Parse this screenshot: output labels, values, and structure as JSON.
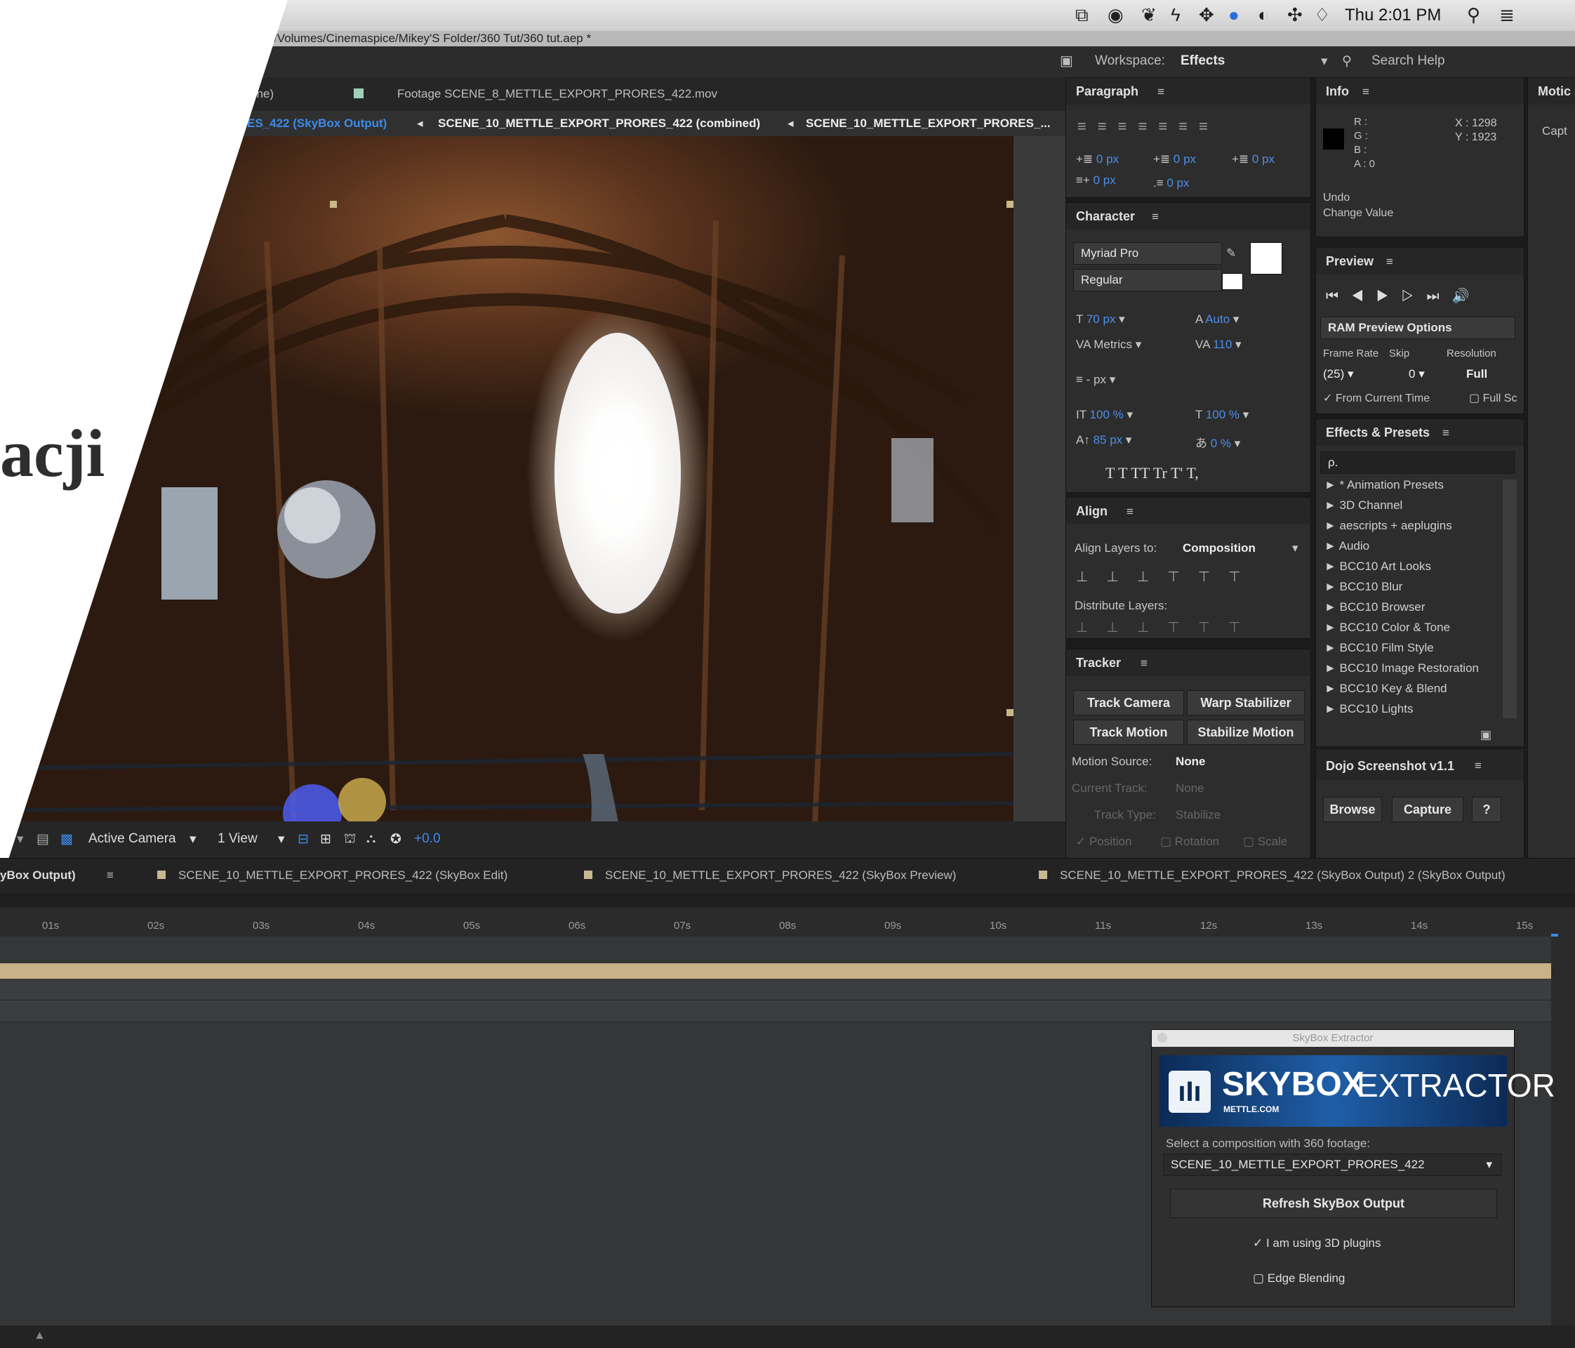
{
  "menubar": {
    "clock": "Thu 2:01 PM"
  },
  "path": "/Volumes/Cinemaspice/Mikey'S Folder/360 Tut/360 tut.aep *",
  "overlay_text": "acji",
  "workspace": {
    "label": "Workspace:",
    "value": "Effects",
    "search": "Search Help"
  },
  "viewer": {
    "top_tabs": [
      "one)",
      "Footage SCENE_8_METTLE_EXPORT_PRORES_422.mov"
    ],
    "comp_tabs": [
      "ES_422 (SkyBox Output)",
      "SCENE_10_METTLE_EXPORT_PRORES_422 (combined)",
      "SCENE_10_METTLE_EXPORT_PRORES_..."
    ],
    "toolbar": {
      "camera": "Active Camera",
      "view": "1 View",
      "exposure": "+0.0"
    }
  },
  "paragraph": {
    "title": "Paragraph",
    "indents": [
      "0 px",
      "0 px",
      "0 px",
      "0 px",
      "0 px"
    ]
  },
  "character": {
    "title": "Character",
    "font": "Myriad Pro",
    "style": "Regular",
    "size": "70 px",
    "leading": "Auto",
    "kerning": "Metrics",
    "tracking": "110",
    "stroke": "- px",
    "vscale": "100 %",
    "hscale": "100 %",
    "baseline": "85 px",
    "tsume": "0 %",
    "styles": "T  T  TT  Tr  T'  T,"
  },
  "align": {
    "title": "Align",
    "align_to_label": "Align Layers to:",
    "align_to": "Composition",
    "distribute": "Distribute Layers:"
  },
  "tracker": {
    "title": "Tracker",
    "buttons": [
      "Track Camera",
      "Warp Stabilizer",
      "Track Motion",
      "Stabilize Motion"
    ],
    "motion_source_label": "Motion Source:",
    "motion_source": "None",
    "current_track_label": "Current Track:",
    "current_track": "None",
    "track_type_label": "Track Type:",
    "track_type": "Stabilize",
    "checks": [
      "Position",
      "Rotation",
      "Scale"
    ]
  },
  "info": {
    "title": "Info",
    "r": "R :",
    "g": "G :",
    "b": "B :",
    "a": "A : 0",
    "x": "X : 1298",
    "y": "Y : 1923",
    "undo": "Undo",
    "change": "Change Value"
  },
  "preview": {
    "title": "Preview",
    "ram": "RAM Preview Options",
    "frame_rate_label": "Frame Rate",
    "skip_label": "Skip",
    "resolution_label": "Resolution",
    "frame_rate": "(25)",
    "skip": "0",
    "resolution": "Full",
    "from_current": "From Current Time",
    "full_screen": "Full Sc"
  },
  "effects": {
    "title": "Effects & Presets",
    "search": "ρ.",
    "items": [
      "* Animation Presets",
      "3D Channel",
      "aescripts + aeplugins",
      "Audio",
      "BCC10 Art Looks",
      "BCC10 Blur",
      "BCC10 Browser",
      "BCC10 Color & Tone",
      "BCC10 Film Style",
      "BCC10 Image Restoration",
      "BCC10 Key & Blend",
      "BCC10 Lights"
    ]
  },
  "dojo": {
    "title": "Dojo Screenshot v1.1",
    "browse": "Browse",
    "capture": "Capture",
    "help": "?"
  },
  "motion": {
    "title": "Motic",
    "capt": "Capt"
  },
  "timeline": {
    "tabs": [
      "yBox Output)",
      "SCENE_10_METTLE_EXPORT_PRORES_422 (SkyBox Edit)",
      "SCENE_10_METTLE_EXPORT_PRORES_422 (SkyBox Preview)",
      "SCENE_10_METTLE_EXPORT_PRORES_422 (SkyBox Output) 2 (SkyBox Output)"
    ],
    "ticks": [
      "01s",
      "02s",
      "03s",
      "04s",
      "05s",
      "06s",
      "07s",
      "08s",
      "09s",
      "10s",
      "11s",
      "12s",
      "13s",
      "14s",
      "15s"
    ]
  },
  "skybox": {
    "window_title": "SkyBox Extractor",
    "brand": "SKYBOX",
    "brand2": "EXTRACTOR",
    "site": "METTLE.COM",
    "select_label": "Select a composition with 360 footage:",
    "comp": "SCENE_10_METTLE_EXPORT_PRORES_422",
    "refresh": "Refresh SkyBox Output",
    "plugins": "I am using 3D plugins",
    "edge": "Edge Blending"
  }
}
